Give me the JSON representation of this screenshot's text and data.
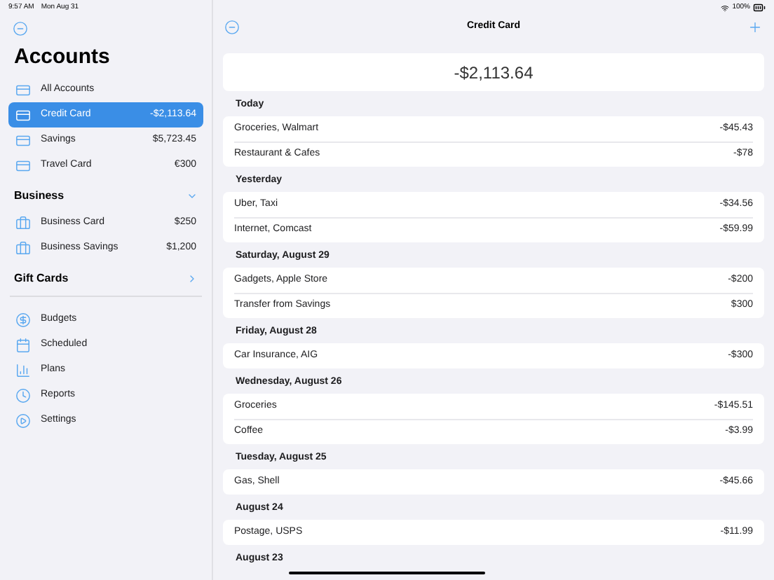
{
  "status_bar": {
    "time": "9:57 AM",
    "date": "Mon Aug 31",
    "battery": "100%"
  },
  "sidebar": {
    "title": "Accounts",
    "accounts": [
      {
        "name": "All Accounts",
        "selected": false
      },
      {
        "name": "Credit Card",
        "amount": "-$2,113.64",
        "selected": true
      },
      {
        "name": "Savings",
        "amount": "$5,723.45",
        "selected": false
      },
      {
        "name": "Travel Card",
        "amount": "€300",
        "selected": false
      }
    ],
    "groups": [
      {
        "title": "Business",
        "expanded": true,
        "items": [
          {
            "name": "Business Card",
            "amount": "$250",
            "selected": false
          },
          {
            "name": "Business Savings",
            "amount": "$1,200",
            "selected": false
          }
        ]
      },
      {
        "title": "Gift Cards",
        "expanded": false
      }
    ],
    "nav": [
      {
        "label": "Budgets",
        "kind": "budgets"
      },
      {
        "label": "Scheduled",
        "kind": "scheduled"
      },
      {
        "label": "Plans",
        "kind": "plans"
      },
      {
        "label": "Reports",
        "kind": "reports"
      },
      {
        "label": "Settings",
        "kind": "settings"
      }
    ]
  },
  "main": {
    "title": "Credit Card",
    "balance": "-$2,113.64",
    "sections": [
      {
        "date": "Today",
        "rows": [
          {
            "payee": "Groceries, Walmart",
            "amount": "-$45.43"
          },
          {
            "payee": "Restaurant & Cafes",
            "amount": "-$78"
          }
        ]
      },
      {
        "date": "Yesterday",
        "rows": [
          {
            "payee": "Uber, Taxi",
            "amount": "-$34.56"
          },
          {
            "payee": "Internet, Comcast",
            "amount": "-$59.99"
          }
        ]
      },
      {
        "date": "Saturday, August 29",
        "rows": [
          {
            "payee": "Gadgets, Apple Store",
            "amount": "-$200"
          },
          {
            "payee": "Transfer from Savings",
            "amount": "$300"
          }
        ]
      },
      {
        "date": "Friday, August 28",
        "rows": [
          {
            "payee": "Car Insurance, AIG",
            "amount": "-$300"
          }
        ]
      },
      {
        "date": "Wednesday, August 26",
        "rows": [
          {
            "payee": "Groceries",
            "amount": "-$145.51"
          },
          {
            "payee": "Coffee",
            "amount": "-$3.99"
          }
        ]
      },
      {
        "date": "Tuesday, August 25",
        "rows": [
          {
            "payee": "Gas, Shell",
            "amount": "-$45.66"
          }
        ]
      },
      {
        "date": "August 24",
        "rows": [
          {
            "payee": "Postage, USPS",
            "amount": "-$11.99"
          }
        ]
      },
      {
        "date": "August 23"
      }
    ]
  }
}
